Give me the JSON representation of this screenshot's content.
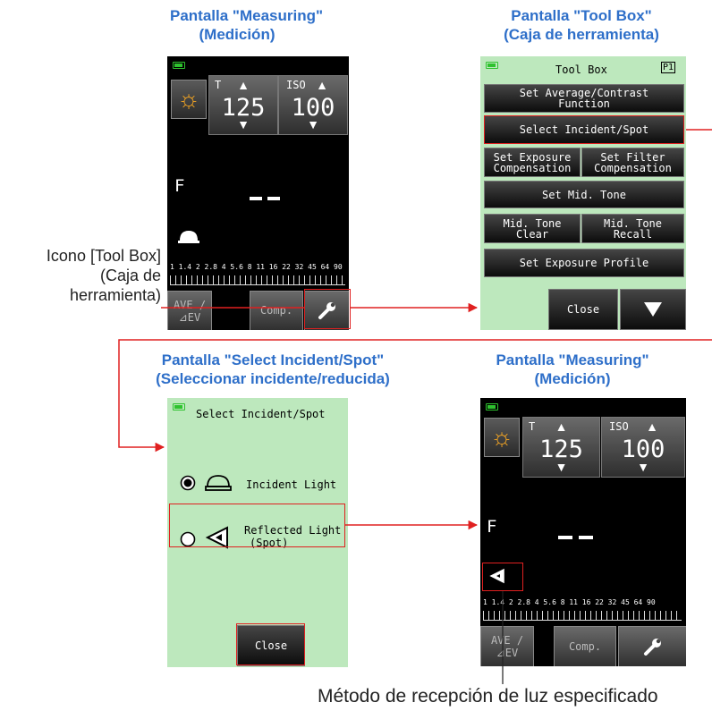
{
  "captions": {
    "top_left": [
      "Pantalla \"Measuring\"",
      "(Medición)"
    ],
    "top_right": [
      "Pantalla \"Tool Box\"",
      "(Caja de herramienta)"
    ],
    "bottom_left": [
      "Pantalla \"Select Incident/Spot\"",
      "(Seleccionar incidente/reducida)"
    ],
    "bottom_right": [
      "Pantalla \"Measuring\"",
      "(Medición)"
    ]
  },
  "toolbox_label": [
    "Icono [Tool Box]",
    "(Caja de",
    "herramienta)"
  ],
  "bottom_label": "Método de recepción de luz especificado",
  "meter": {
    "t_label": "T",
    "iso_label": "ISO",
    "t_value": "125",
    "iso_value": "100",
    "f_label": "F",
    "scale": "1 1.4 2 2.8 4 5.6 8 11 16 22 32 45 64 90",
    "ave_label": "AVE /",
    "ev_label": "⊿EV",
    "comp_label": "Comp."
  },
  "toolbox": {
    "title": "Tool Box",
    "page": "P1",
    "btn_average": "Set Average/Contrast\nFunction",
    "btn_select": "Select Incident/Spot",
    "btn_expcomp": "Set Exposure\nCompensation",
    "btn_filter": "Set Filter\nCompensation",
    "btn_midtone": "Set Mid. Tone",
    "btn_mtclear": "Mid. Tone\nClear",
    "btn_mtrecall": "Mid. Tone\nRecall",
    "btn_profile": "Set Exposure Profile",
    "btn_close": "Close"
  },
  "select_screen": {
    "title": "Select Incident/Spot",
    "incident": "Incident Light",
    "reflected": "Reflected Light",
    "spot": "(Spot)",
    "close": "Close"
  },
  "colors": {
    "caption": "#2e6fc9",
    "arrow": "#e02020",
    "screen_green": "#bde8bd"
  }
}
